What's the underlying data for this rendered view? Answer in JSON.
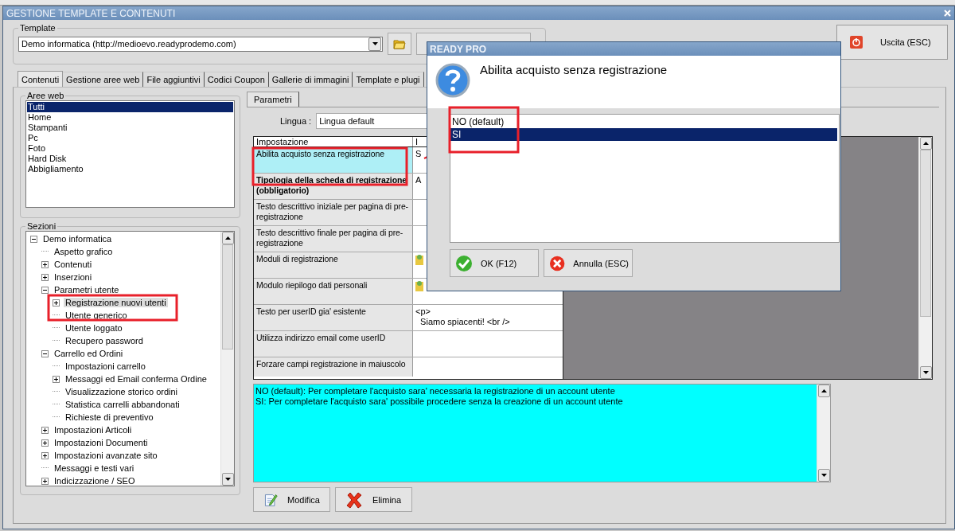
{
  "window": {
    "title": "GESTIONE TEMPLATE E CONTENUTI"
  },
  "template": {
    "label": "Template",
    "value": "Demo informatica (http://medioevo.readyprodemo.com)"
  },
  "exit_button": {
    "label": "Uscita (ESC)"
  },
  "tabs": [
    {
      "label": "Contenuti",
      "selected": true
    },
    {
      "label": "Gestione aree web",
      "selected": false
    },
    {
      "label": "File aggiuntivi",
      "selected": false
    },
    {
      "label": "Codici Coupon",
      "selected": false
    },
    {
      "label": "Gallerie di immagini",
      "selected": false
    },
    {
      "label": "Template e plugi",
      "selected": false
    }
  ],
  "web_areas": {
    "label": "Aree web",
    "items": [
      {
        "label": "Tutti",
        "selected": true
      },
      {
        "label": "Home",
        "selected": false
      },
      {
        "label": "Stampanti",
        "selected": false
      },
      {
        "label": "Pc",
        "selected": false
      },
      {
        "label": "Foto",
        "selected": false
      },
      {
        "label": "Hard Disk",
        "selected": false
      },
      {
        "label": "Abbigliamento",
        "selected": false
      }
    ]
  },
  "sections": {
    "label": "Sezioni",
    "tree": [
      {
        "label": "Demo informatica",
        "kind": "folder",
        "expanded": true,
        "selected": false,
        "children": [
          {
            "label": "Aspetto grafico",
            "kind": "leaf",
            "selected": false
          },
          {
            "label": "Contenuti",
            "kind": "folder",
            "expanded": false,
            "selected": false
          },
          {
            "label": "Inserzioni",
            "kind": "folder",
            "expanded": false,
            "selected": false
          },
          {
            "label": "Parametri utente",
            "kind": "folder",
            "expanded": true,
            "selected": false,
            "children": [
              {
                "label": "Registrazione nuovi utenti",
                "kind": "folder",
                "expanded": false,
                "selected": true
              },
              {
                "label": "Utente generico",
                "kind": "leaf",
                "selected": false
              },
              {
                "label": "Utente loggato",
                "kind": "leaf",
                "selected": false
              },
              {
                "label": "Recupero password",
                "kind": "leaf",
                "selected": false
              }
            ]
          },
          {
            "label": "Carrello ed Ordini",
            "kind": "folder",
            "expanded": true,
            "selected": false,
            "children": [
              {
                "label": "Impostazioni carrello",
                "kind": "leaf",
                "selected": false
              },
              {
                "label": "Messaggi ed Email conferma Ordine",
                "kind": "folder",
                "expanded": false,
                "selected": false
              },
              {
                "label": "Visualizzazione storico ordini",
                "kind": "leaf",
                "selected": false
              },
              {
                "label": "Statistica carrelli abbandonati",
                "kind": "leaf",
                "selected": false
              },
              {
                "label": "Richieste di preventivo",
                "kind": "leaf",
                "selected": false
              }
            ]
          },
          {
            "label": "Impostazioni Articoli",
            "kind": "folder",
            "expanded": false,
            "selected": false
          },
          {
            "label": "Impostazioni Documenti",
            "kind": "folder",
            "expanded": false,
            "selected": false
          },
          {
            "label": "Impostazioni avanzate sito",
            "kind": "folder",
            "expanded": false,
            "selected": false
          },
          {
            "label": "Messaggi e testi vari",
            "kind": "leaf",
            "selected": false
          },
          {
            "label": "Indicizzazione / SEO",
            "kind": "folder",
            "expanded": false,
            "selected": false
          }
        ]
      }
    ]
  },
  "params_tab": {
    "label": "Parametri"
  },
  "language": {
    "label": "Lingua :",
    "value": "Lingua default"
  },
  "settings_table": {
    "columns": [
      "Impostazione",
      "I"
    ],
    "rows": [
      {
        "name": "Abilita acquisto senza registrazione",
        "bold": false,
        "selected": true,
        "value": "S"
      },
      {
        "name": "Tipologia della scheda di registrazione (obbligatorio)",
        "bold": true,
        "selected": false,
        "value": "A"
      },
      {
        "name": "Testo descrittivo iniziale per pagina di pre-registrazione",
        "bold": false,
        "selected": false
      },
      {
        "name": "Testo descrittivo finale per pagina di pre-registrazione",
        "bold": false,
        "selected": false
      },
      {
        "name": "Moduli di registrazione",
        "bold": false,
        "selected": false,
        "icon": true
      },
      {
        "name": "Modulo riepilogo dati personali",
        "bold": false,
        "selected": false,
        "icon": true
      },
      {
        "name": "Testo per userID gia' esistente",
        "bold": false,
        "selected": false,
        "value": "<p>\n  Siamo spiacenti! <br />"
      },
      {
        "name": "Utilizza indirizzo email come userID",
        "bold": false,
        "selected": false
      },
      {
        "name": "Forzare campi registrazione in maiuscolo",
        "bold": false,
        "selected": false
      }
    ]
  },
  "description": [
    "NO (default): Per completare l'acquisto sara' necessaria la registrazione di un account utente",
    "SI: Per completare l'acquisto sara' possibile procedere senza la creazione di un account utente"
  ],
  "actions": [
    {
      "label": "Modifica",
      "kind": "edit"
    },
    {
      "label": "Elimina",
      "kind": "delete"
    }
  ],
  "dialog": {
    "title": "READY PRO",
    "question": "Abilita acquisto senza registrazione",
    "options": [
      {
        "label": "NO (default)",
        "selected": false
      },
      {
        "label": "SI",
        "selected": true
      }
    ],
    "buttons": [
      {
        "label": "OK (F12)",
        "kind": "ok"
      },
      {
        "label": "Annulla (ESC)",
        "kind": "cancel"
      }
    ]
  }
}
